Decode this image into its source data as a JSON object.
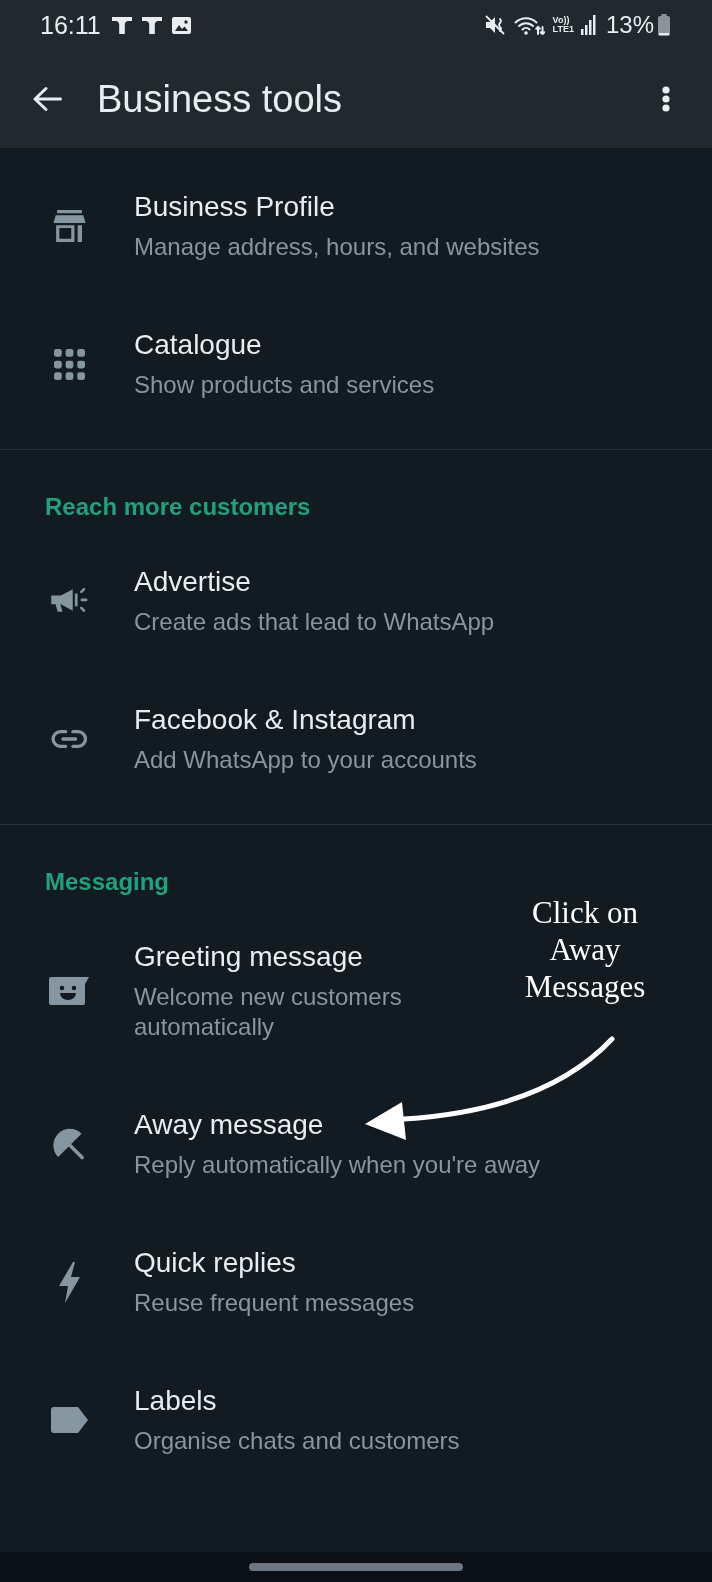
{
  "status_bar": {
    "time": "16:11",
    "network_label": "Vo))\nLTE1",
    "battery": "13%"
  },
  "app_bar": {
    "title": "Business tools"
  },
  "sections": [
    {
      "items": [
        {
          "kind": "profile",
          "title": "Business Profile",
          "subtitle": "Manage address, hours, and websites"
        },
        {
          "kind": "catalogue",
          "title": "Catalogue",
          "subtitle": "Show products and services"
        }
      ]
    },
    {
      "header": "Reach more customers",
      "items": [
        {
          "kind": "advertise",
          "title": "Advertise",
          "subtitle": "Create ads that lead to WhatsApp"
        },
        {
          "kind": "link",
          "title": "Facebook & Instagram",
          "subtitle": "Add WhatsApp to your accounts"
        }
      ]
    },
    {
      "header": "Messaging",
      "items": [
        {
          "kind": "greeting",
          "title": "Greeting message",
          "subtitle": "Welcome new customers\nautomatically"
        },
        {
          "kind": "away",
          "title": "Away message",
          "subtitle": "Reply automatically when you're away"
        },
        {
          "kind": "quick_replies",
          "title": "Quick replies",
          "subtitle": "Reuse frequent messages"
        },
        {
          "kind": "labels",
          "title": "Labels",
          "subtitle": "Organise chats and customers"
        }
      ]
    }
  ],
  "annotation": {
    "text": "Click on\nAway\nMessages"
  }
}
